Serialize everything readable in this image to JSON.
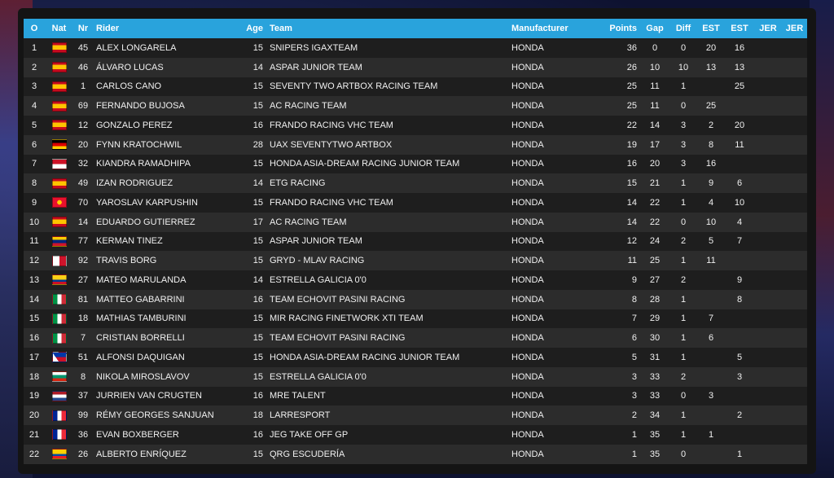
{
  "colors": {
    "header_bg": "#29a3dc",
    "row_odd": "#1e1e1e",
    "row_even": "#2c2c2c"
  },
  "columns": [
    "O",
    "Nat",
    "Nr",
    "Rider",
    "Age",
    "Team",
    "Manufacturer",
    "Points",
    "Gap",
    "Diff",
    "EST",
    "EST",
    "JER",
    "JER"
  ],
  "rows": [
    {
      "pos": "1",
      "flag": "spain-flag",
      "nr": "45",
      "rider": "ALEX LONGARELA",
      "age": "15",
      "team": "SNIPERS IGAXTEAM",
      "man": "HONDA",
      "points": "36",
      "gap": "0",
      "diff": "0",
      "est1": "20",
      "est2": "16",
      "jer1": "",
      "jer2": ""
    },
    {
      "pos": "2",
      "flag": "spain-flag",
      "nr": "46",
      "rider": "Álvaro Lucas",
      "age": "14",
      "team": "ASPAR JUNIOR TEAM",
      "man": "HONDA",
      "points": "26",
      "gap": "10",
      "diff": "10",
      "est1": "13",
      "est2": "13",
      "jer1": "",
      "jer2": ""
    },
    {
      "pos": "3",
      "flag": "spain-flag",
      "nr": "1",
      "rider": "CARLOS CANO",
      "age": "15",
      "team": "SEVENTY TWO ARTBOX RACING TEAM",
      "man": "HONDA",
      "points": "25",
      "gap": "11",
      "diff": "1",
      "est1": "",
      "est2": "25",
      "jer1": "",
      "jer2": ""
    },
    {
      "pos": "4",
      "flag": "spain-flag",
      "nr": "69",
      "rider": "FERNANDO BUJOSA",
      "age": "15",
      "team": "AC RACING TEAM",
      "man": "HONDA",
      "points": "25",
      "gap": "11",
      "diff": "0",
      "est1": "25",
      "est2": "",
      "jer1": "",
      "jer2": ""
    },
    {
      "pos": "5",
      "flag": "spain-flag",
      "nr": "12",
      "rider": "GONZALO PEREZ",
      "age": "16",
      "team": "FRANDO RACING VHC TEAM",
      "man": "HONDA",
      "points": "22",
      "gap": "14",
      "diff": "3",
      "est1": "2",
      "est2": "20",
      "jer1": "",
      "jer2": ""
    },
    {
      "pos": "6",
      "flag": "germany-flag",
      "nr": "20",
      "rider": "FYNN KRATOCHWIL",
      "age": "28",
      "team": "UAX SEVENTYTWO ARTBOX",
      "man": "HONDA",
      "points": "19",
      "gap": "17",
      "diff": "3",
      "est1": "8",
      "est2": "11",
      "jer1": "",
      "jer2": ""
    },
    {
      "pos": "7",
      "flag": "indonesia-flag",
      "nr": "32",
      "rider": "KIANDRA RAMADHIPA",
      "age": "15",
      "team": "HONDA ASIA-DREAM RACING JUNIOR TEAM",
      "man": "HONDA",
      "points": "16",
      "gap": "20",
      "diff": "3",
      "est1": "16",
      "est2": "",
      "jer1": "",
      "jer2": ""
    },
    {
      "pos": "8",
      "flag": "spain-flag",
      "nr": "49",
      "rider": "IZAN RODRIGUEZ",
      "age": "14",
      "team": "ETG RACING",
      "man": "HONDA",
      "points": "15",
      "gap": "21",
      "diff": "1",
      "est1": "9",
      "est2": "6",
      "jer1": "",
      "jer2": ""
    },
    {
      "pos": "9",
      "flag": "kyrgyzstan-flag",
      "nr": "70",
      "rider": "YAROSLAV KARPUSHIN",
      "age": "15",
      "team": "FRANDO RACING VHC TEAM",
      "man": "HONDA",
      "points": "14",
      "gap": "22",
      "diff": "1",
      "est1": "4",
      "est2": "10",
      "jer1": "",
      "jer2": ""
    },
    {
      "pos": "10",
      "flag": "spain-flag",
      "nr": "14",
      "rider": "EDUARDO GUTIERREZ",
      "age": "17",
      "team": "AC RACING TEAM",
      "man": "HONDA",
      "points": "14",
      "gap": "22",
      "diff": "0",
      "est1": "10",
      "est2": "4",
      "jer1": "",
      "jer2": ""
    },
    {
      "pos": "11",
      "flag": "venezuela-flag",
      "nr": "77",
      "rider": "KERMAN TINEZ",
      "age": "15",
      "team": "ASPAR JUNIOR TEAM",
      "man": "HONDA",
      "points": "12",
      "gap": "24",
      "diff": "2",
      "est1": "5",
      "est2": "7",
      "jer1": "",
      "jer2": ""
    },
    {
      "pos": "12",
      "flag": "malta-flag",
      "nr": "92",
      "rider": "TRAVIS BORG",
      "age": "15",
      "team": "GRYD - MLAV RACING",
      "man": "HONDA",
      "points": "11",
      "gap": "25",
      "diff": "1",
      "est1": "11",
      "est2": "",
      "jer1": "",
      "jer2": ""
    },
    {
      "pos": "13",
      "flag": "colombia-flag",
      "nr": "27",
      "rider": "MATEO MARULANDA",
      "age": "14",
      "team": "ESTRELLA GALICIA 0'0",
      "man": "HONDA",
      "points": "9",
      "gap": "27",
      "diff": "2",
      "est1": "",
      "est2": "9",
      "jer1": "",
      "jer2": ""
    },
    {
      "pos": "14",
      "flag": "italy-flag",
      "nr": "81",
      "rider": "MATTEO GABARRINI",
      "age": "16",
      "team": "TEAM ECHOVIT PASINI RACING",
      "man": "HONDA",
      "points": "8",
      "gap": "28",
      "diff": "1",
      "est1": "",
      "est2": "8",
      "jer1": "",
      "jer2": ""
    },
    {
      "pos": "15",
      "flag": "italy-flag",
      "nr": "18",
      "rider": "MATHIAS TAMBURINI",
      "age": "15",
      "team": "MIR RACING FINETWORK XTI TEAM",
      "man": "HONDA",
      "points": "7",
      "gap": "29",
      "diff": "1",
      "est1": "7",
      "est2": "",
      "jer1": "",
      "jer2": ""
    },
    {
      "pos": "16",
      "flag": "italy-flag",
      "nr": "7",
      "rider": "CRISTIAN BORRELLI",
      "age": "15",
      "team": "TEAM ECHOVIT PASINI RACING",
      "man": "HONDA",
      "points": "6",
      "gap": "30",
      "diff": "1",
      "est1": "6",
      "est2": "",
      "jer1": "",
      "jer2": ""
    },
    {
      "pos": "17",
      "flag": "philippines-flag",
      "nr": "51",
      "rider": "ALFONSI DAQUIGAN",
      "age": "15",
      "team": "HONDA ASIA-DREAM RACING JUNIOR TEAM",
      "man": "HONDA",
      "points": "5",
      "gap": "31",
      "diff": "1",
      "est1": "",
      "est2": "5",
      "jer1": "",
      "jer2": ""
    },
    {
      "pos": "18",
      "flag": "bulgaria-flag",
      "nr": "8",
      "rider": "NIKOLA MIROSLAVOV",
      "age": "15",
      "team": "ESTRELLA GALICIA 0'0",
      "man": "HONDA",
      "points": "3",
      "gap": "33",
      "diff": "2",
      "est1": "",
      "est2": "3",
      "jer1": "",
      "jer2": ""
    },
    {
      "pos": "19",
      "flag": "netherlands-flag",
      "nr": "37",
      "rider": "JURRIEN VAN CRUGTEN",
      "age": "16",
      "team": "MRE TALENT",
      "man": "HONDA",
      "points": "3",
      "gap": "33",
      "diff": "0",
      "est1": "3",
      "est2": "",
      "jer1": "",
      "jer2": ""
    },
    {
      "pos": "20",
      "flag": "france-flag",
      "nr": "99",
      "rider": "RÉMY GEORGES SANJUAN",
      "age": "18",
      "team": "LARRESPORT",
      "man": "HONDA",
      "points": "2",
      "gap": "34",
      "diff": "1",
      "est1": "",
      "est2": "2",
      "jer1": "",
      "jer2": ""
    },
    {
      "pos": "21",
      "flag": "france-flag",
      "nr": "36",
      "rider": "EVAN BOXBERGER",
      "age": "16",
      "team": "JEG TAKE OFF GP",
      "man": "HONDA",
      "points": "1",
      "gap": "35",
      "diff": "1",
      "est1": "1",
      "est2": "",
      "jer1": "",
      "jer2": ""
    },
    {
      "pos": "22",
      "flag": "ecuador-flag",
      "nr": "26",
      "rider": "ALBERTO ENRÍQUEZ",
      "age": "15",
      "team": "QRG ESCUDERÍA",
      "man": "HONDA",
      "points": "1",
      "gap": "35",
      "diff": "0",
      "est1": "",
      "est2": "1",
      "jer1": "",
      "jer2": ""
    }
  ]
}
